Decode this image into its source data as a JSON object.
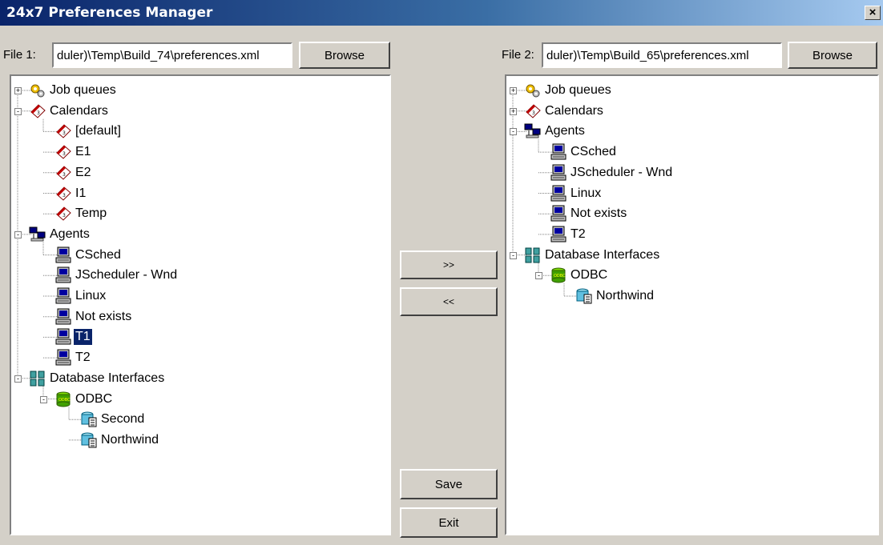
{
  "window": {
    "title": "24x7 Preferences Manager",
    "close_label": "×"
  },
  "left": {
    "file_label": "File 1:",
    "path": "duler)\\Temp\\Build_74\\preferences.xml",
    "browse_label": "Browse",
    "tree": [
      {
        "label": "Job queues",
        "icon": "gears-icon",
        "expander": "+"
      },
      {
        "label": "Calendars",
        "icon": "calendar-icon",
        "expander": "-"
      },
      {
        "label": "[default]",
        "icon": "calendar-icon"
      },
      {
        "label": "E1",
        "icon": "calendar-icon"
      },
      {
        "label": "E2",
        "icon": "calendar-icon"
      },
      {
        "label": "I1",
        "icon": "calendar-icon"
      },
      {
        "label": "Temp",
        "icon": "calendar-icon"
      },
      {
        "label": "Agents",
        "icon": "network-computers-icon",
        "expander": "-"
      },
      {
        "label": "CSched",
        "icon": "computer-icon"
      },
      {
        "label": "JScheduler - Wnd",
        "icon": "computer-icon"
      },
      {
        "label": "Linux",
        "icon": "computer-icon"
      },
      {
        "label": "Not exists",
        "icon": "computer-icon"
      },
      {
        "label": "T1",
        "icon": "computer-icon",
        "selected": true
      },
      {
        "label": "T2",
        "icon": "computer-icon"
      },
      {
        "label": "Database Interfaces",
        "icon": "database-group-icon",
        "expander": "-"
      },
      {
        "label": "ODBC",
        "icon": "odbc-icon",
        "expander": "-"
      },
      {
        "label": "Second",
        "icon": "datasource-icon"
      },
      {
        "label": "Northwind",
        "icon": "datasource-icon"
      }
    ]
  },
  "right": {
    "file_label": "File 2:",
    "path": "duler)\\Temp\\Build_65\\preferences.xml",
    "browse_label": "Browse",
    "tree": [
      {
        "label": "Job queues",
        "icon": "gears-icon",
        "expander": "+"
      },
      {
        "label": "Calendars",
        "icon": "calendar-icon",
        "expander": "+"
      },
      {
        "label": "Agents",
        "icon": "network-computers-icon",
        "expander": "-"
      },
      {
        "label": "CSched",
        "icon": "computer-icon"
      },
      {
        "label": "JScheduler - Wnd",
        "icon": "computer-icon"
      },
      {
        "label": "Linux",
        "icon": "computer-icon"
      },
      {
        "label": "Not exists",
        "icon": "computer-icon"
      },
      {
        "label": "T2",
        "icon": "computer-icon"
      },
      {
        "label": "Database Interfaces",
        "icon": "database-group-icon",
        "expander": "-"
      },
      {
        "label": "ODBC",
        "icon": "odbc-icon",
        "expander": "-"
      },
      {
        "label": "Northwind",
        "icon": "datasource-icon"
      }
    ]
  },
  "actions": {
    "copy_right_label": ">>",
    "copy_left_label": "<<",
    "save_label": "Save",
    "exit_label": "Exit"
  }
}
